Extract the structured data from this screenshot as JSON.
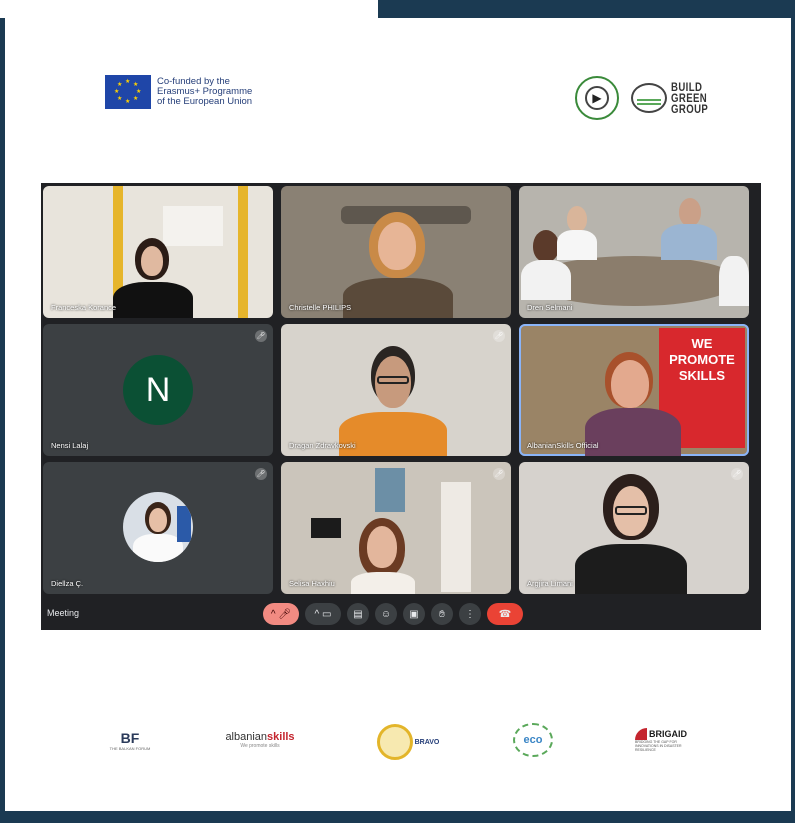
{
  "header": {
    "eu_text": [
      "Co-funded by the",
      "Erasmus+ Programme",
      "of the European Union"
    ],
    "partner_text": [
      "BUILD",
      "GREEN",
      "GROUP"
    ]
  },
  "meeting": {
    "label": "Meeting",
    "participants": [
      {
        "name": "Franceska Korance"
      },
      {
        "name": "Christelle PHILIPS"
      },
      {
        "name": "Dren Selmani"
      },
      {
        "name": "Nensi Lalaj",
        "initial": "N"
      },
      {
        "name": "Dragan Zdravkovski"
      },
      {
        "name": "AlbanianSkills Official",
        "banner": [
          "WE",
          "PROMOTE",
          "SKILLS"
        ]
      },
      {
        "name": "Diellza Ç."
      },
      {
        "name": "Selisa Haxhiu"
      },
      {
        "name": "Argjira Limani"
      }
    ]
  },
  "footer": {
    "logos": [
      {
        "main": "BF",
        "sub": "THE BALKAN FORUM"
      },
      {
        "main_prefix": "albanian",
        "main_accent": "skills",
        "sub": "We promote skills"
      },
      {
        "main": "BRAVO"
      },
      {
        "main": "eco"
      },
      {
        "main": "BRIGAID",
        "sub": "BRIDGING THE GAP FOR INNOVATIONS IN DISASTER RESILIENCE"
      }
    ]
  },
  "colors": {
    "frame": "#1b3a52",
    "meet_bg": "#202124",
    "tile_bg": "#3c4043",
    "accent_red": "#ea4335",
    "eu_blue": "#1f46a8"
  }
}
